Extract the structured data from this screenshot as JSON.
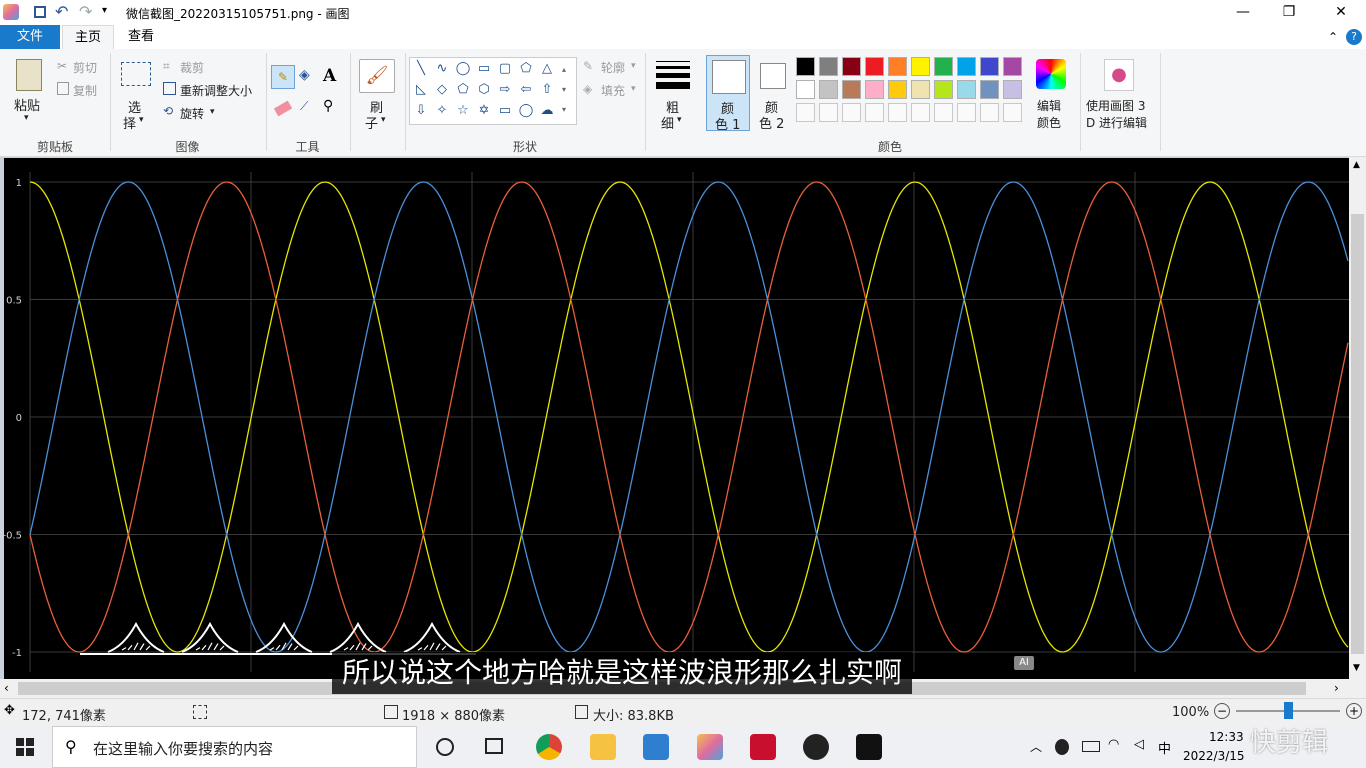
{
  "titlebar": {
    "title": "微信截图_20220315105751.png - 画图"
  },
  "tabs": {
    "file": "文件",
    "home": "主页",
    "view": "查看"
  },
  "ribbon": {
    "clipboard": {
      "paste": "粘贴",
      "cut": "剪切",
      "copy": "复制",
      "label": "剪贴板"
    },
    "image": {
      "select": "选",
      "select2": "择",
      "crop": "裁剪",
      "resize": "重新调整大小",
      "rotate": "旋转",
      "label": "图像"
    },
    "tools": {
      "label": "工具"
    },
    "brushes": {
      "label": "刷",
      "label2": "子"
    },
    "shapes": {
      "outline": "轮廓",
      "fill": "填充",
      "label": "形状"
    },
    "size": {
      "label": "粗",
      "label2": "细"
    },
    "color1": {
      "label": "颜",
      "label2": "色 1"
    },
    "color2": {
      "label": "颜",
      "label2": "色 2"
    },
    "edit_colors": {
      "label": "编辑",
      "label2": "颜色"
    },
    "paint3d": {
      "label": "使用画图 3",
      "label2": "D 进行编辑"
    },
    "colors_label": "颜色",
    "palette_row1": [
      "#000000",
      "#7f7f7f",
      "#880015",
      "#ed1c24",
      "#ff7f27",
      "#fff200",
      "#22b14c",
      "#00a2e8",
      "#3f48cc",
      "#a349a4"
    ],
    "palette_row2": [
      "#ffffff",
      "#c3c3c3",
      "#b97a57",
      "#ffaec9",
      "#ffc90e",
      "#efe4b0",
      "#b5e61d",
      "#99d9ea",
      "#7092be",
      "#c8bfe7"
    ]
  },
  "canvas": {
    "y_ticks": [
      "1",
      "0.5",
      "0",
      "-0.5",
      "-1"
    ]
  },
  "chart_data": {
    "type": "line",
    "ylim": [
      -1,
      1
    ],
    "grid": true,
    "y_ticks": [
      1,
      0.5,
      0,
      -0.5,
      -1
    ],
    "series": [
      {
        "color": "#e6e600",
        "phase_deg": 0,
        "cycles": 4.5
      },
      {
        "color": "#4a90d9",
        "phase_deg": -120,
        "cycles": 4.5
      },
      {
        "color": "#e8603a",
        "phase_deg": 120,
        "cycles": 4.5
      }
    ]
  },
  "subtitle": "所以说这个地方哈就是这样波浪形那么扎实啊",
  "subtitle_badge": "AI",
  "status": {
    "cursor": "172, 741像素",
    "image_size": "1918 × 880像素",
    "file_size": "大小: 83.8KB",
    "zoom": "100%"
  },
  "taskbar": {
    "search_placeholder": "在这里输入你要搜索的内容",
    "time": "12:33",
    "date": "2022/3/15",
    "watermark": "快剪辑"
  },
  "colors": {
    "accent": "#1979ca",
    "canvas_bg": "#000000"
  }
}
